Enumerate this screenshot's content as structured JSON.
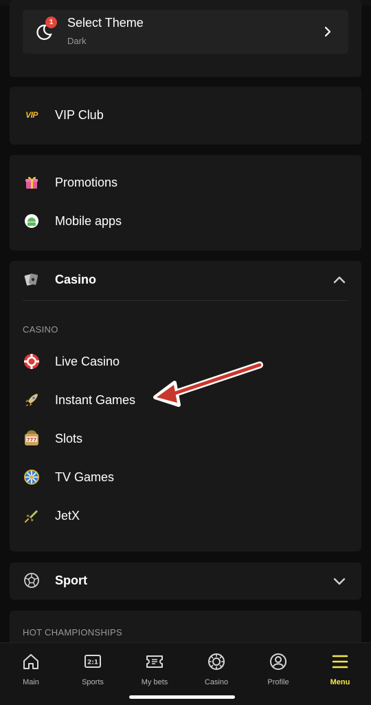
{
  "theme": {
    "title": "Select Theme",
    "value": "Dark",
    "badge_count": "1"
  },
  "vip": {
    "icon_text": "VIP",
    "label": "VIP Club"
  },
  "misc": [
    {
      "label": "Promotions"
    },
    {
      "label": "Mobile apps"
    }
  ],
  "casino": {
    "label": "Casino",
    "section_header": "CASINO",
    "items": [
      {
        "label": "Live Casino"
      },
      {
        "label": "Instant Games"
      },
      {
        "label": "Slots"
      },
      {
        "label": "TV Games"
      },
      {
        "label": "JetX"
      }
    ]
  },
  "sport": {
    "label": "Sport"
  },
  "hot": {
    "section_header": "HOT CHAMPIONSHIPS"
  },
  "nav": [
    {
      "label": "Main"
    },
    {
      "label": "Sports",
      "icon_text": "2:1"
    },
    {
      "label": "My bets"
    },
    {
      "label": "Casino"
    },
    {
      "label": "Profile"
    },
    {
      "label": "Menu"
    }
  ],
  "colors": {
    "accent": "#f5e84a",
    "badge": "#e2463c",
    "vip": "#f0b92a",
    "arrow": "#c8372d"
  }
}
